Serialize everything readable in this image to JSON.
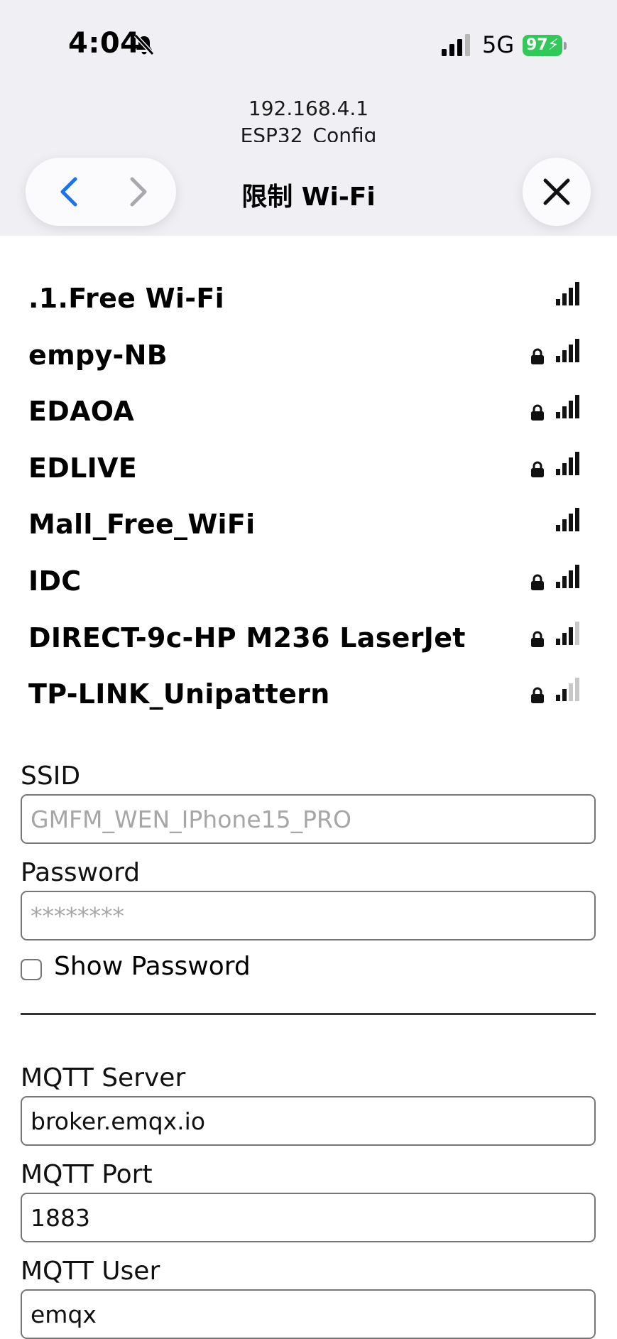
{
  "status_bar": {
    "time": "4:04",
    "network": "5G",
    "battery": "97"
  },
  "browser": {
    "url": "192.168.4.1",
    "page_title": "ESP32_Config",
    "sheet_title": "限制 Wi-Fi"
  },
  "networks": [
    {
      "name": ".1.Free Wi-Fi",
      "locked": false,
      "signal": 4
    },
    {
      "name": "empy-NB",
      "locked": true,
      "signal": 4
    },
    {
      "name": "EDAOA",
      "locked": true,
      "signal": 4
    },
    {
      "name": "EDLIVE",
      "locked": true,
      "signal": 4
    },
    {
      "name": "Mall_Free_WiFi",
      "locked": false,
      "signal": 4
    },
    {
      "name": "IDC",
      "locked": true,
      "signal": 4
    },
    {
      "name": "DIRECT-9c-HP M236 LaserJet",
      "locked": true,
      "signal": 3
    },
    {
      "name": "TP-LINK_Unipattern",
      "locked": true,
      "signal": 2
    }
  ],
  "form": {
    "ssid_label": "SSID",
    "ssid_placeholder": "GMFM_WEN_IPhone15_PRO",
    "password_label": "Password",
    "password_placeholder": "********",
    "show_password_label": "Show Password",
    "mqtt_server_label": "MQTT Server",
    "mqtt_server_value": "broker.emqx.io",
    "mqtt_port_label": "MQTT Port",
    "mqtt_port_value": "1883",
    "mqtt_user_label": "MQTT User",
    "mqtt_user_value": "emqx"
  },
  "colors": {
    "accent": "#1a73e8",
    "battery": "#34c759",
    "chrome_bg": "#f0f0f4"
  }
}
